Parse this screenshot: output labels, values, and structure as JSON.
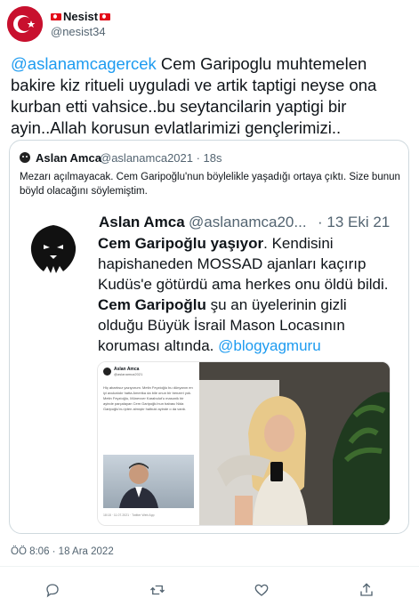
{
  "author": {
    "name": "Nesist",
    "handle": "@nesist34"
  },
  "tweet": {
    "mention": "@aslanamcagercek",
    "text": " Cem Garipoglu muhtemelen bakire kiz ritueli uyguladi ve artik taptigi neyse ona kurban etti vahsice..bu seytancilarin yaptigi bir ayin..Allah korusun evlatlarimizi gençlerimizi..",
    "time": "ÖÖ 8:06 · 18 Ara 2022"
  },
  "quote": {
    "name": "Aslan Amca",
    "handle": "@aslanamca2021 · 18s",
    "text": "Mezarı açılmayacak. Cem Garipoğlu'nun böylelikle yaşadığı ortaya çıktı. Size bunun böyld olacağını söylemiştim.",
    "inner": {
      "name": "Aslan Amca",
      "handle": "@aslanamca20...",
      "date": "· 13 Eki 21",
      "bold1": "Cem Garipoğlu yaşıyor",
      "t1": ". Kendisini hapishaneden MOSSAD ajanları kaçırıp Kudüs'e götürdü ama herkes onu öldü bildi. ",
      "bold2": "Cem Garipoğlu",
      "t2": " şu an üyelerinin gizli olduğu Büyük İsrail Mason Locasının koruması altında. ",
      "mention": "@blogyagmuru"
    },
    "screenshot": {
      "name": "Aslan Amca",
      "handle": "@aslanamca2021",
      "text": "Hiç abartısız yazıyorum. Metin Feyzioğlu bu dünyanın en iyi avukatıdır hatta Amerika da bile onun bir benzeri yok. Metin Feyzioğlu, Münevver Karabulut'u masonik bir ayinde parçalayan Cem Garipoğlu'nun babası Nida Garipoğlu'nu ipten almıştır halbuki ayinde o da vardı.",
      "footer": "18:18 · 11.07.2021 · Twitter Web App"
    }
  },
  "actions": [
    "reply-icon",
    "retweet-icon",
    "like-icon",
    "share-icon"
  ],
  "colors": {
    "link": "#1d9bf0",
    "muted": "#536471",
    "flag": "#e30a17"
  }
}
